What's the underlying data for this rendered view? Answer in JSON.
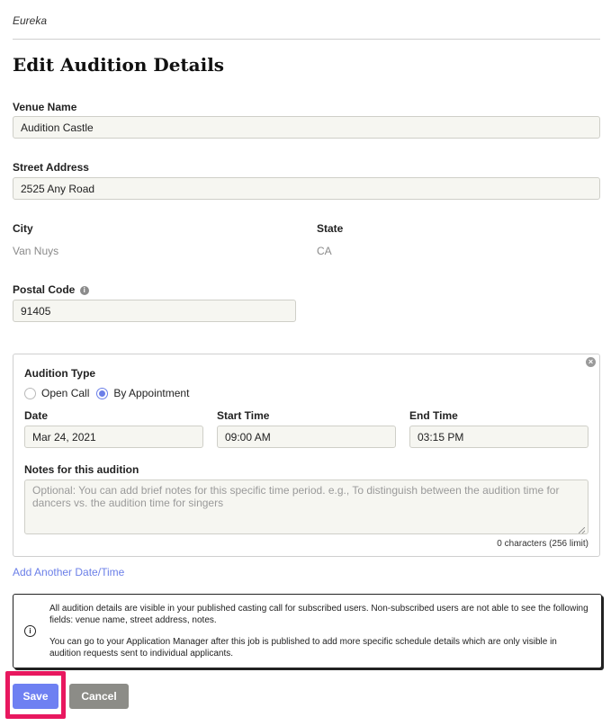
{
  "header": {
    "project_name": "Eureka",
    "page_title": "Edit Audition Details"
  },
  "venue": {
    "label": "Venue Name",
    "value": "Audition Castle"
  },
  "street": {
    "label": "Street Address",
    "value": "2525 Any Road"
  },
  "city": {
    "label": "City",
    "value": "Van Nuys"
  },
  "state": {
    "label": "State",
    "value": "CA"
  },
  "postal": {
    "label": "Postal Code",
    "value": "91405",
    "info_icon": "info-icon"
  },
  "schedule": {
    "audition_type_label": "Audition Type",
    "options": [
      {
        "label": "Open Call",
        "selected": false
      },
      {
        "label": "By Appointment",
        "selected": true
      }
    ],
    "date_label": "Date",
    "date_value": "Mar 24, 2021",
    "start_label": "Start Time",
    "start_value": "09:00 AM",
    "end_label": "End Time",
    "end_value": "03:15 PM",
    "notes_label": "Notes for this audition",
    "notes_placeholder": "Optional: You can add brief notes for this specific time period. e.g., To distinguish between the audition time for dancers vs. the audition time for singers",
    "notes_value": "",
    "char_count": "0 characters (256 limit)",
    "close_icon": "close-circle-icon"
  },
  "add_link": "Add Another Date/Time",
  "notice": {
    "icon": "info-circle-icon",
    "paragraph1": "All audition details are visible in your published casting call for subscribed users. Non-subscribed users are not able to see the following fields: venue name, street address, notes.",
    "paragraph2": "You can go to your Application Manager after this job is published to add more specific schedule details which are only visible in audition requests sent to individual applicants."
  },
  "actions": {
    "save_label": "Save",
    "cancel_label": "Cancel"
  },
  "colors": {
    "accent": "#6e80f2",
    "highlight": "#e8185f",
    "cancel": "#8c8c87"
  }
}
